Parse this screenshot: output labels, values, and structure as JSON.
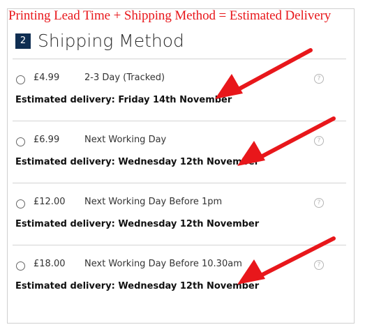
{
  "banner": "Printing Lead Time + Shipping Method = Estimated Delivery",
  "section": {
    "step": "2",
    "title": "Shipping Method"
  },
  "options": [
    {
      "price": "£4.99",
      "method": "2-3 Day (Tracked)",
      "estimate": "Estimated delivery: Friday 14th November",
      "help": "?"
    },
    {
      "price": "£6.99",
      "method": "Next Working Day",
      "estimate": "Estimated delivery: Wednesday 12th November",
      "help": "?"
    },
    {
      "price": "£12.00",
      "method": "Next Working Day Before 1pm",
      "estimate": "Estimated delivery: Wednesday 12th November",
      "help": "?"
    },
    {
      "price": "£18.00",
      "method": "Next Working Day Before 10.30am",
      "estimate": "Estimated delivery: Wednesday 12th November",
      "help": "?"
    }
  ],
  "colors": {
    "accent": "#e8171b",
    "step_badge": "#0f2e52",
    "divider": "#d3d3d3"
  },
  "icons": {
    "help": "question-circle-icon",
    "annotation": "red-arrow-icon"
  }
}
